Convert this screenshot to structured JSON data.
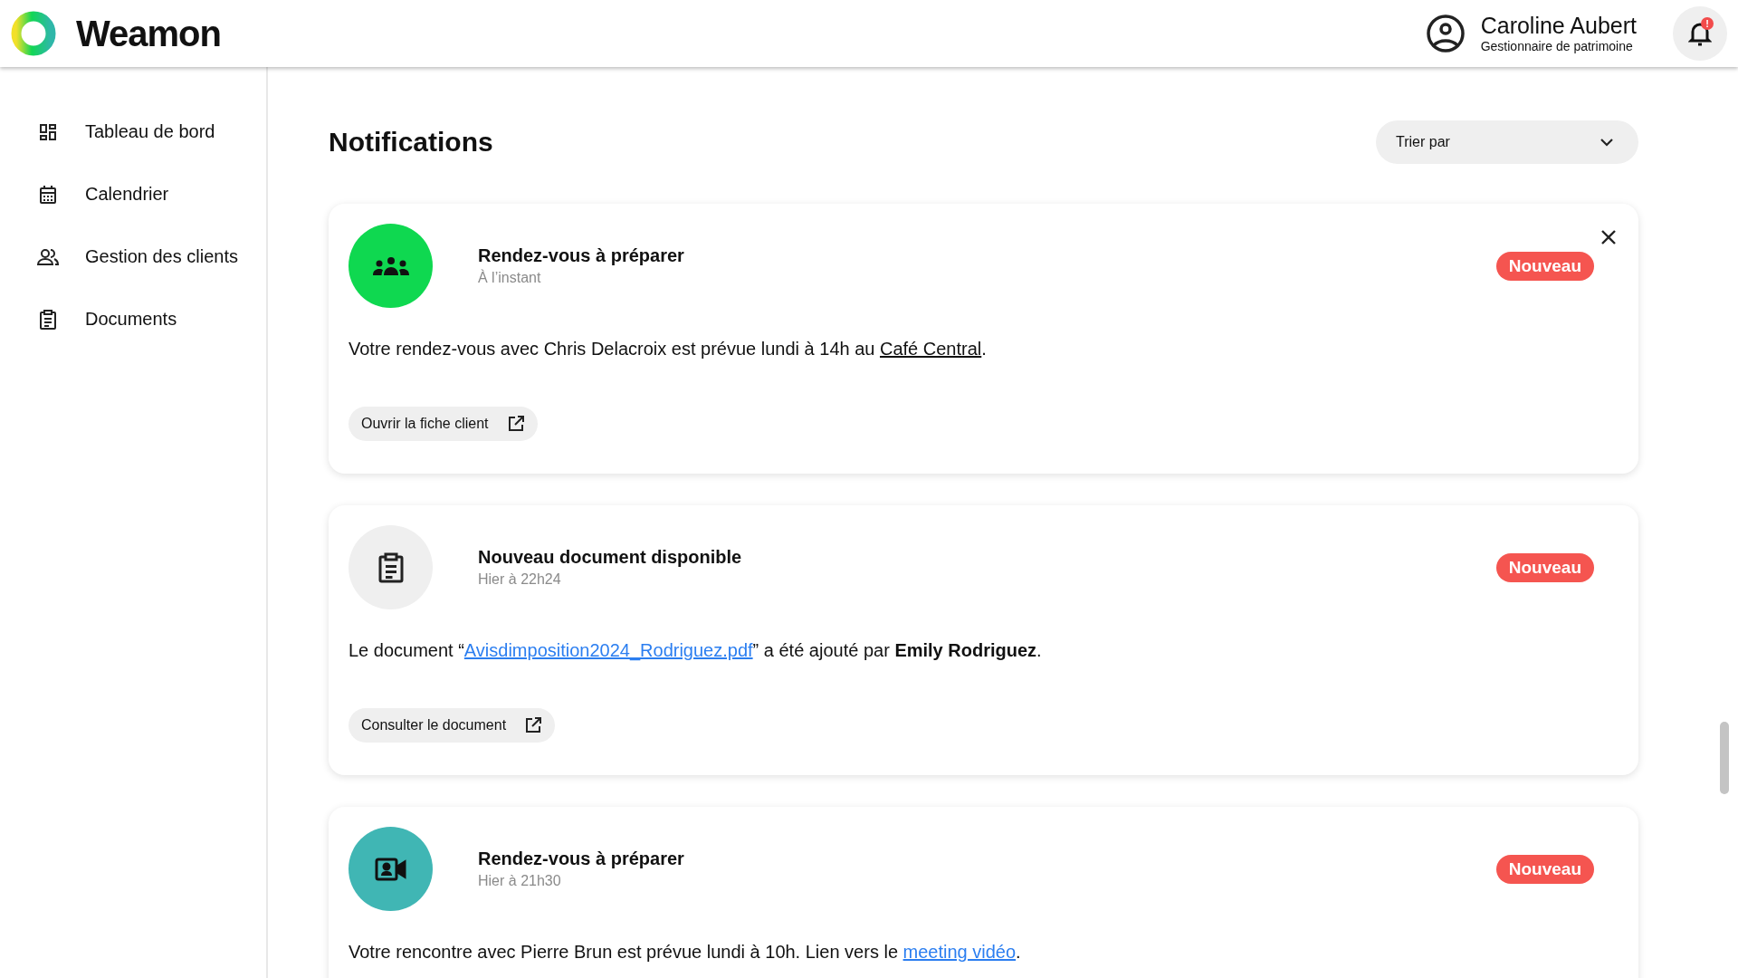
{
  "header": {
    "brand": "Weamon",
    "user": {
      "name": "Caroline Aubert",
      "role": "Gestionnaire de patrimoine"
    },
    "notifications_badge": "!"
  },
  "sidebar": {
    "items": [
      {
        "kind": "dashboard",
        "label": "Tableau de bord"
      },
      {
        "kind": "calendar",
        "label": "Calendrier"
      },
      {
        "kind": "people",
        "label": "Gestion des clients"
      },
      {
        "kind": "document",
        "label": "Documents"
      }
    ]
  },
  "page": {
    "title": "Notifications",
    "sort": {
      "placeholder": "Trier par"
    }
  },
  "notifications": [
    {
      "kind": "group",
      "color": "#0fd850",
      "title": "Rendez-vous à préparer",
      "time": "À l’instant",
      "badge": "Nouveau",
      "dismissible": true,
      "message": [
        {
          "kind": "text",
          "text": "Votre rendez-vous avec Chris Delacroix est prévue lundi à 14h au "
        },
        {
          "kind": "underline",
          "text": "Café Central"
        },
        {
          "kind": "text",
          "text": "."
        }
      ],
      "action": {
        "label": "Ouvrir la fiche client"
      }
    },
    {
      "kind": "document",
      "color": "#efefef",
      "title": "Nouveau document disponible",
      "time": "Hier à 22h24",
      "badge": "Nouveau",
      "dismissible": false,
      "message": [
        {
          "kind": "text",
          "text": "Le document “"
        },
        {
          "kind": "link",
          "text": "Avisdimposition2024_Rodriguez.pdf"
        },
        {
          "kind": "text",
          "text": "” a été ajouté par "
        },
        {
          "kind": "bold",
          "text": "Emily Rodriguez"
        },
        {
          "kind": "text",
          "text": "."
        }
      ],
      "action": {
        "label": "Consulter le document"
      }
    },
    {
      "kind": "video",
      "color": "#40b6b4",
      "title": "Rendez-vous à préparer",
      "time": "Hier à 21h30",
      "badge": "Nouveau",
      "dismissible": false,
      "message": [
        {
          "kind": "text",
          "text": "Votre rencontre avec Pierre Brun est prévue lundi à 10h. Lien vers le "
        },
        {
          "kind": "link",
          "text": "meeting vidéo"
        },
        {
          "kind": "text",
          "text": "."
        }
      ]
    }
  ]
}
